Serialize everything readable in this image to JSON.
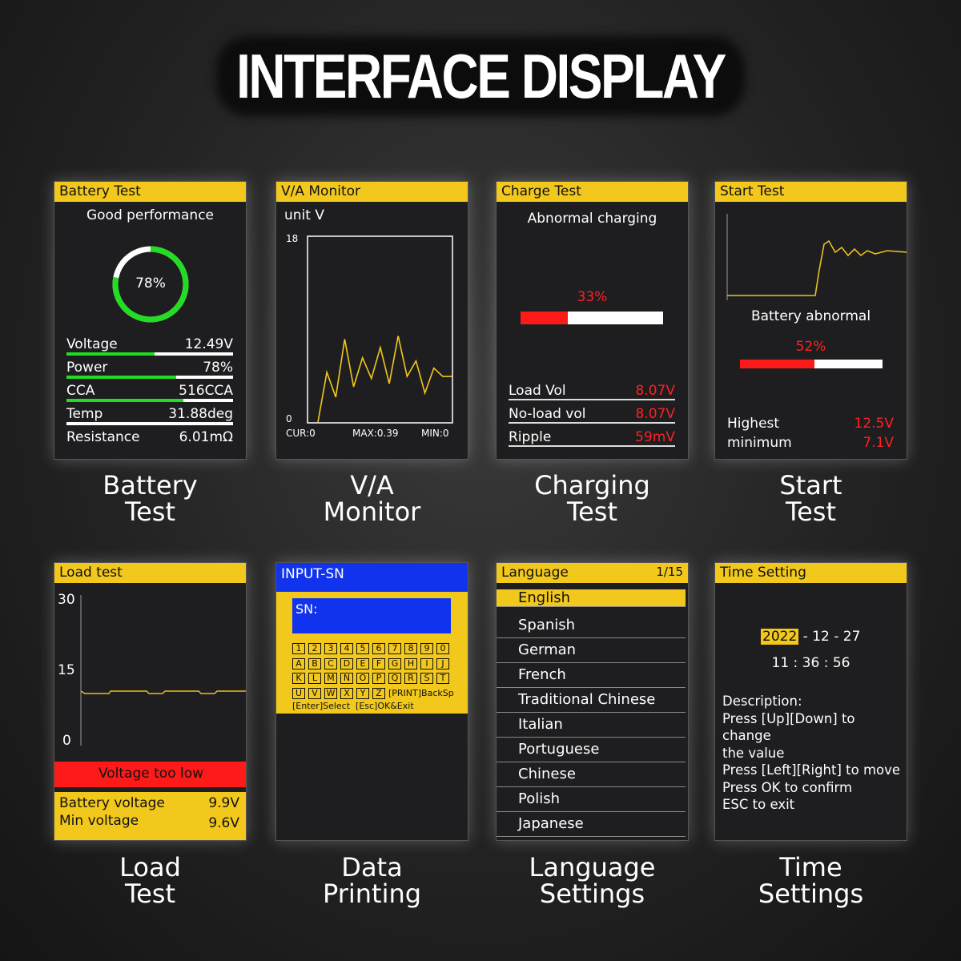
{
  "title": "INTERFACE DISPLAY",
  "colors": {
    "yellow": "#f2c81c",
    "green": "#22dd22",
    "red": "#ff1a1a",
    "blue": "#1133ee"
  },
  "battery": {
    "header": "Battery Test",
    "status": "Good performance",
    "percent": "78%",
    "percent_value": 78,
    "rows": [
      {
        "label": "Voltage",
        "value": "12.49V",
        "fill": 0.53
      },
      {
        "label": "Power",
        "value": "78%",
        "fill": 0.66
      },
      {
        "label": "CCA",
        "value": "516CCA",
        "fill": 0.7
      },
      {
        "label": "Temp",
        "value": "31.88deg",
        "fill": 0
      },
      {
        "label": "Resistance",
        "value": "6.01mΩ"
      }
    ],
    "caption": [
      "Battery",
      "Test"
    ]
  },
  "va": {
    "header": "V/A Monitor",
    "unit": "unit V",
    "ymax": "18",
    "ymin": "0",
    "cur": "CUR:0",
    "max": "MAX:0.39",
    "min": "MIN:0",
    "series": [
      0,
      4.8,
      2.4,
      8,
      3.4,
      6.2,
      4.2,
      7.2,
      3.7,
      8.3,
      4.4,
      5.9,
      2.8,
      5.2,
      4.4,
      4.4
    ],
    "ylim": [
      0,
      18
    ],
    "caption": [
      "V/A",
      "Monitor"
    ]
  },
  "charge": {
    "header": "Charge Test",
    "status": "Abnormal charging",
    "percent": "33%",
    "percent_value": 33,
    "rows": [
      {
        "label": "Load Vol",
        "value": "8.07V"
      },
      {
        "label": "No-load vol",
        "value": "8.07V"
      },
      {
        "label": "Ripple",
        "value": "59mV"
      }
    ],
    "caption": [
      "Charging",
      "Test"
    ]
  },
  "start": {
    "header": "Start Test",
    "status": "Battery abnormal",
    "percent": "52%",
    "percent_value": 52,
    "rows": [
      {
        "label": "Highest",
        "value": "12.5V"
      },
      {
        "label": "minimum",
        "value": "7.1V"
      }
    ],
    "caption": [
      "Start",
      "Test"
    ]
  },
  "load": {
    "header": "Load test",
    "ticks": [
      "30",
      "15",
      "0"
    ],
    "alert": "Voltage too low",
    "rows": [
      {
        "label": "Battery voltage",
        "value": "9.9V"
      },
      {
        "label": "Min voltage",
        "value": "9.6V"
      }
    ],
    "caption": [
      "Load",
      "Test"
    ]
  },
  "print": {
    "header": "INPUT-SN",
    "sn_label": "SN:",
    "keys": [
      [
        "1",
        "2",
        "3",
        "4",
        "5",
        "6",
        "7",
        "8",
        "9",
        "0"
      ],
      [
        "A",
        "B",
        "C",
        "D",
        "E",
        "F",
        "G",
        "H",
        "I",
        "J"
      ],
      [
        "K",
        "L",
        "M",
        "N",
        "O",
        "P",
        "Q",
        "R",
        "S",
        "T"
      ],
      [
        "U",
        "V",
        "W",
        "X",
        "Y",
        "Z"
      ]
    ],
    "print_back": "[PRINT]BackSp",
    "help": "[Enter]Select  [Esc]OK&Exit",
    "caption": [
      "Data",
      "Printing"
    ]
  },
  "language": {
    "header": "Language",
    "page": "1/15",
    "selected": 0,
    "items": [
      "English",
      "Spanish",
      "German",
      "French",
      "Traditional Chinese",
      "Italian",
      "Portuguese",
      "Chinese",
      "Polish",
      "Japanese"
    ],
    "caption": [
      "Language",
      "Settings"
    ]
  },
  "time": {
    "header": "Time Setting",
    "year": "2022",
    "date_rest": " - 12 - 27",
    "time": "11 : 36 : 56",
    "description": [
      "Description:",
      "Press [Up][Down] to change",
      "the value",
      "Press [Left][Right] to move",
      "Press OK to confirm",
      "ESC to exit"
    ],
    "caption": [
      "Time",
      "Settings"
    ]
  }
}
